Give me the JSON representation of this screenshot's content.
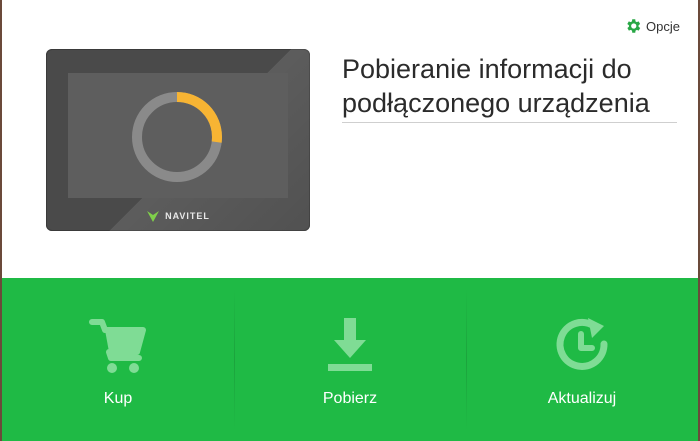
{
  "header": {
    "options_label": "Opcje",
    "options_icon": "gear-icon"
  },
  "device": {
    "brand": "NAVITEL",
    "progress_fraction": 0.27,
    "colors": {
      "progress": "#f7b433",
      "track": "#8a8a8a"
    }
  },
  "main": {
    "heading": "Pobieranie informacji do podłączonego urządzenia"
  },
  "actions": [
    {
      "label": "Kup",
      "icon": "cart-icon"
    },
    {
      "label": "Pobierz",
      "icon": "download-icon"
    },
    {
      "label": "Aktualizuj",
      "icon": "update-icon"
    }
  ],
  "colors": {
    "accent": "#1fba45",
    "icon_tint": "#7fdc95",
    "gear": "#28a745"
  }
}
